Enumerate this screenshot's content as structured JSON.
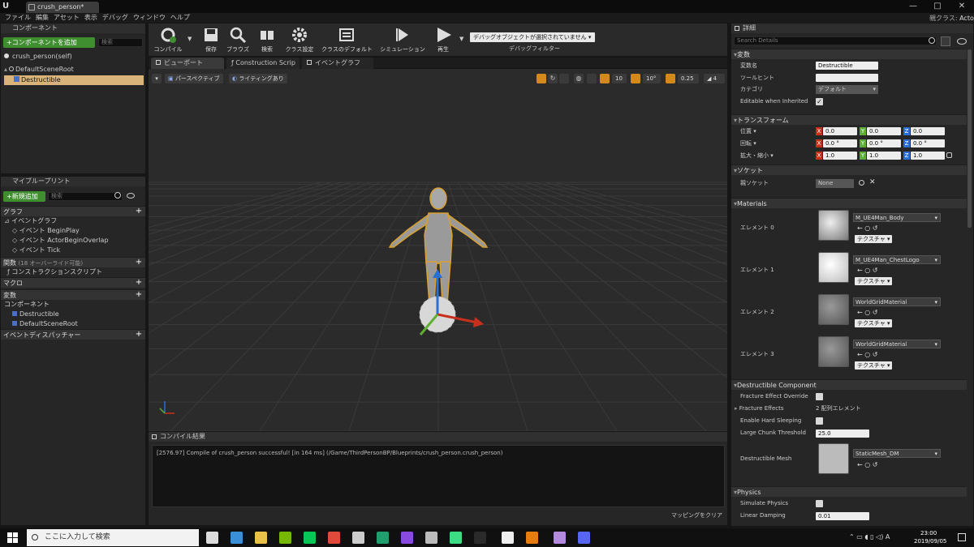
{
  "window": {
    "tab_title": "crush_person*",
    "parent_class_label": "親クラス:",
    "parent_class_value": "Actor",
    "min": "—",
    "max": "□",
    "close": "✕"
  },
  "menu": [
    "ファイル",
    "編集",
    "アセット",
    "表示",
    "デバッグ",
    "ウィンドウ",
    "ヘルプ"
  ],
  "components": {
    "header": "コンポーネント",
    "add_button": "+コンポーネントを追加",
    "search_placeholder": "検索",
    "self_label": "crush_person(self)",
    "tree": [
      "DefaultSceneRoot",
      "Destructible"
    ]
  },
  "myblueprint": {
    "header": "マイブループリント",
    "new_button": "+新規追加",
    "search_placeholder": "検索",
    "graph_header": "グラフ",
    "event_graph": "イベントグラフ",
    "events": [
      "イベント BeginPlay",
      "イベント ActorBeginOverlap",
      "イベント Tick"
    ],
    "functions_header": "関数",
    "functions_note": "(18 オーバーライド可能)",
    "construction_script": "コンストラクションスクリプト",
    "macros_header": "マクロ",
    "variables_header": "変数",
    "components_header": "コンポーネント",
    "component_vars": [
      "Destructible",
      "DefaultSceneRoot"
    ],
    "dispatchers_header": "イベントディスパッチャー"
  },
  "toolbar": {
    "buttons": [
      "コンパイル",
      "保存",
      "ブラウズ",
      "検索",
      "クラス設定",
      "クラスのデフォルト",
      "シミュレーション",
      "再生"
    ],
    "debug_dropdown": "デバッグオブジェクトが選択されていません",
    "debug_filter": "デバッグフィルター"
  },
  "editor_tabs": [
    "ビューポート",
    "Construction Scrip",
    "イベントグラフ"
  ],
  "viewport": {
    "perspective": "パースペクティブ",
    "lighting": "ライティングあり",
    "grid_snap": "10",
    "rot_snap": "10°",
    "scale_snap": "0.25",
    "cam_speed": "4"
  },
  "compile": {
    "header": "コンパイル結果",
    "message": "[2576.97] Compile of crush_person successful! [in 164 ms] (/Game/ThirdPersonBP/Blueprints/crush_person.crush_person)",
    "clear_button": "マッピングをクリア"
  },
  "details": {
    "header": "詳細",
    "search_placeholder": "Search Details",
    "sections": {
      "variables": "変数",
      "transform": "トランスフォーム",
      "socket": "ソケット",
      "materials": "Materials",
      "destructible": "Destructible Component",
      "physics": "Physics"
    },
    "var_name_label": "変数名",
    "var_name_value": "Destructible",
    "tooltip_label": "ツールヒント",
    "category_label": "カテゴリ",
    "category_value": "デフォルト",
    "editable_label": "Editable when Inherited",
    "location_label": "位置",
    "rotation_label": "回転",
    "scale_label": "拡大・縮小",
    "location": [
      "0.0",
      "0.0",
      "0.0"
    ],
    "rotation": [
      "0.0 °",
      "0.0 °",
      "0.0 °"
    ],
    "scale": [
      "1.0",
      "1.0",
      "1.0"
    ],
    "parent_socket_label": "親ソケット",
    "parent_socket_value": "None",
    "elements": [
      {
        "label": "エレメント 0",
        "material": "M_UE4Man_Body"
      },
      {
        "label": "エレメント 1",
        "material": "M_UE4Man_ChestLogo"
      },
      {
        "label": "エレメント 2",
        "material": "WorldGridMaterial"
      },
      {
        "label": "エレメント 3",
        "material": "WorldGridMaterial"
      }
    ],
    "texture_btn": "テクスチャ",
    "fracture_override": "Fracture Effect Override",
    "fracture_effects": "Fracture Effects",
    "fracture_effects_value": "2 配列エレメント",
    "hard_sleeping": "Enable Hard Sleeping",
    "chunk_threshold": "Large Chunk Threshold",
    "chunk_threshold_value": "25.0",
    "dest_mesh_label": "Destructible Mesh",
    "dest_mesh_value": "StaticMesh_DM",
    "simulate_physics": "Simulate Physics",
    "linear_damping": "Linear Damping",
    "linear_damping_value": "0.01"
  },
  "taskbar": {
    "search_placeholder": "ここに入力して検索",
    "time": "23:00",
    "date": "2019/09/05"
  }
}
